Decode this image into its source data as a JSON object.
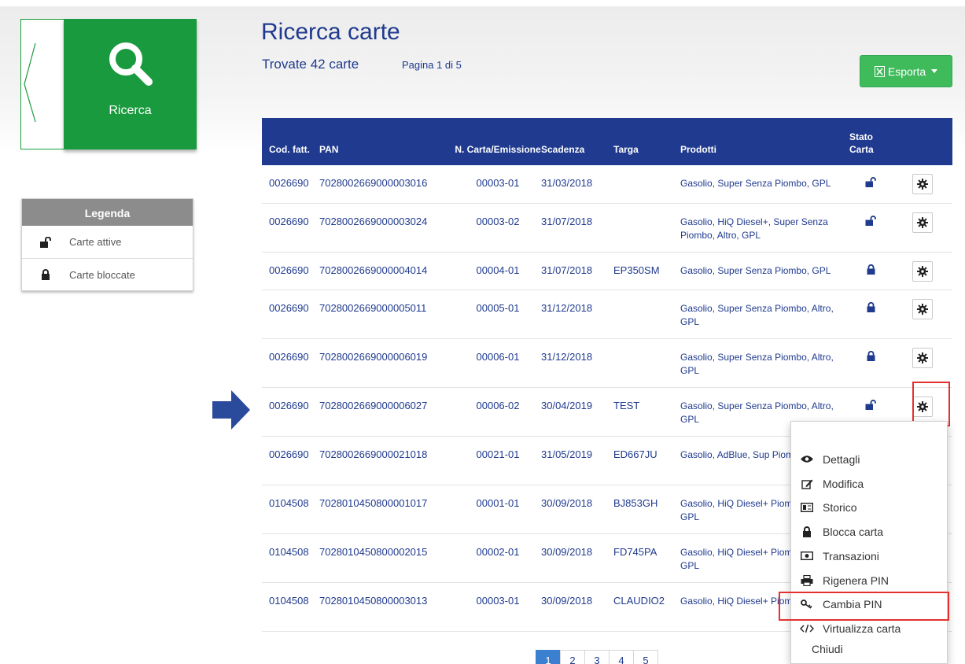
{
  "nav": {
    "search_label": "Ricerca"
  },
  "legend": {
    "title": "Legenda",
    "items": [
      {
        "icon": "unlocked-icon",
        "label": "Carte attive"
      },
      {
        "icon": "locked-icon",
        "label": "Carte bloccate"
      }
    ]
  },
  "header": {
    "title": "Ricerca carte",
    "found": "Trovate 42 carte",
    "page_info": "Pagina 1 di 5",
    "export_label": "Esporta"
  },
  "table": {
    "columns": [
      "Cod. fatt.",
      "PAN",
      "N. Carta/Emissione",
      "Scadenza",
      "Targa",
      "Prodotti",
      "Stato Carta"
    ],
    "rows": [
      {
        "cod": "0026690",
        "pan": "7028002669000003016",
        "num": "00003-01",
        "scad": "31/03/2018",
        "targa": "",
        "prod": "Gasolio, Super Senza Piombo, GPL",
        "stato": "attiva"
      },
      {
        "cod": "0026690",
        "pan": "7028002669000003024",
        "num": "00003-02",
        "scad": "31/07/2018",
        "targa": "",
        "prod": "Gasolio, HiQ Diesel+, Super Senza Piombo, Altro, GPL",
        "stato": "attiva"
      },
      {
        "cod": "0026690",
        "pan": "7028002669000004014",
        "num": "00004-01",
        "scad": "31/07/2018",
        "targa": "EP350SM",
        "prod": "Gasolio, Super Senza Piombo, GPL",
        "stato": "bloccata"
      },
      {
        "cod": "0026690",
        "pan": "7028002669000005011",
        "num": "00005-01",
        "scad": "31/12/2018",
        "targa": "",
        "prod": "Gasolio, Super Senza Piombo, Altro, GPL",
        "stato": "bloccata"
      },
      {
        "cod": "0026690",
        "pan": "7028002669000006019",
        "num": "00006-01",
        "scad": "31/12/2018",
        "targa": "",
        "prod": "Gasolio, Super Senza Piombo, Altro, GPL",
        "stato": "bloccata"
      },
      {
        "cod": "0026690",
        "pan": "7028002669000006027",
        "num": "00006-02",
        "scad": "30/04/2019",
        "targa": "TEST",
        "prod": "Gasolio, Super Senza Piombo, Altro, GPL",
        "stato": "attiva"
      },
      {
        "cod": "0026690",
        "pan": "7028002669000021018",
        "num": "00021-01",
        "scad": "31/05/2019",
        "targa": "ED667JU",
        "prod": "Gasolio, AdBlue, Sup Piombo, GPL",
        "stato": ""
      },
      {
        "cod": "0104508",
        "pan": "7028010450800001017",
        "num": "00001-01",
        "scad": "30/09/2018",
        "targa": "BJ853GH",
        "prod": "Gasolio, HiQ Diesel+ Piombo, Altro, GPL",
        "stato": ""
      },
      {
        "cod": "0104508",
        "pan": "7028010450800002015",
        "num": "00002-01",
        "scad": "30/09/2018",
        "targa": "FD745PA",
        "prod": "Gasolio, HiQ Diesel+ Piombo, Altro, GPL",
        "stato": ""
      },
      {
        "cod": "0104508",
        "pan": "7028010450800003013",
        "num": "00003-01",
        "scad": "30/09/2018",
        "targa": "CLAUDIO2",
        "prod": "Gasolio, HiQ Diesel+ Piombo, Altro, GP",
        "stato": ""
      }
    ]
  },
  "dropdown": {
    "items": [
      {
        "icon": "eye-icon",
        "label": "Dettagli"
      },
      {
        "icon": "edit-icon",
        "label": "Modifica"
      },
      {
        "icon": "history-card-icon",
        "label": "Storico"
      },
      {
        "icon": "lock-icon",
        "label": "Blocca carta"
      },
      {
        "icon": "money-icon",
        "label": "Transazioni"
      },
      {
        "icon": "print-icon",
        "label": "Rigenera PIN"
      },
      {
        "icon": "key-icon",
        "label": "Cambia PIN"
      },
      {
        "icon": "code-icon",
        "label": "Virtualizza carta"
      }
    ],
    "close_label": "Chiudi"
  },
  "pagination": {
    "pages": [
      "1",
      "2",
      "3",
      "4",
      "5"
    ],
    "current": "1"
  },
  "colors": {
    "primary": "#1f3a8e",
    "green": "#1a9a3e",
    "export_green": "#3fbb5c",
    "highlight": "#e53030"
  }
}
